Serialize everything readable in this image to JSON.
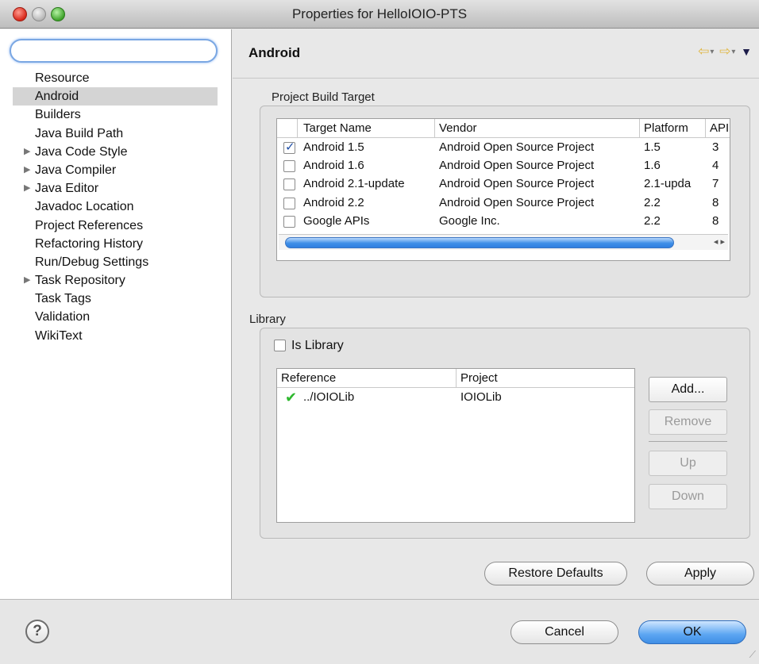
{
  "window": {
    "title": "Properties for HelloIOIO-PTS"
  },
  "filter": {
    "placeholder": ""
  },
  "nav": {
    "items": [
      {
        "label": "Resource",
        "expandable": false,
        "selected": false
      },
      {
        "label": "Android",
        "expandable": false,
        "selected": true
      },
      {
        "label": "Builders",
        "expandable": false,
        "selected": false
      },
      {
        "label": "Java Build Path",
        "expandable": false,
        "selected": false
      },
      {
        "label": "Java Code Style",
        "expandable": true,
        "selected": false
      },
      {
        "label": "Java Compiler",
        "expandable": true,
        "selected": false
      },
      {
        "label": "Java Editor",
        "expandable": true,
        "selected": false
      },
      {
        "label": "Javadoc Location",
        "expandable": false,
        "selected": false
      },
      {
        "label": "Project References",
        "expandable": false,
        "selected": false
      },
      {
        "label": "Refactoring History",
        "expandable": false,
        "selected": false
      },
      {
        "label": "Run/Debug Settings",
        "expandable": false,
        "selected": false
      },
      {
        "label": "Task Repository",
        "expandable": true,
        "selected": false
      },
      {
        "label": "Task Tags",
        "expandable": false,
        "selected": false
      },
      {
        "label": "Validation",
        "expandable": false,
        "selected": false
      },
      {
        "label": "WikiText",
        "expandable": false,
        "selected": false
      }
    ]
  },
  "page": {
    "title": "Android"
  },
  "build_target": {
    "group_label": "Project Build Target",
    "columns": [
      "Target Name",
      "Vendor",
      "Platform",
      "API"
    ],
    "rows": [
      {
        "checked": true,
        "name": "Android 1.5",
        "vendor": "Android Open Source Project",
        "platform": "1.5",
        "api": "3"
      },
      {
        "checked": false,
        "name": "Android 1.6",
        "vendor": "Android Open Source Project",
        "platform": "1.6",
        "api": "4"
      },
      {
        "checked": false,
        "name": "Android 2.1-update",
        "vendor": "Android Open Source Project",
        "platform": "2.1-upda",
        "api": "7"
      },
      {
        "checked": false,
        "name": "Android 2.2",
        "vendor": "Android Open Source Project",
        "platform": "2.2",
        "api": "8"
      },
      {
        "checked": false,
        "name": "Google APIs",
        "vendor": "Google Inc.",
        "platform": "2.2",
        "api": "8"
      }
    ]
  },
  "library": {
    "group_label": "Library",
    "is_library_label": "Is Library",
    "is_library_checked": false,
    "columns": [
      "Reference",
      "Project"
    ],
    "rows": [
      {
        "reference": "../IOIOLib",
        "project": "IOIOLib",
        "status": "ok"
      }
    ],
    "buttons": {
      "add": "Add...",
      "remove": "Remove",
      "up": "Up",
      "down": "Down"
    }
  },
  "actions": {
    "restore_defaults": "Restore Defaults",
    "apply": "Apply",
    "cancel": "Cancel",
    "ok": "OK",
    "help": "?"
  }
}
